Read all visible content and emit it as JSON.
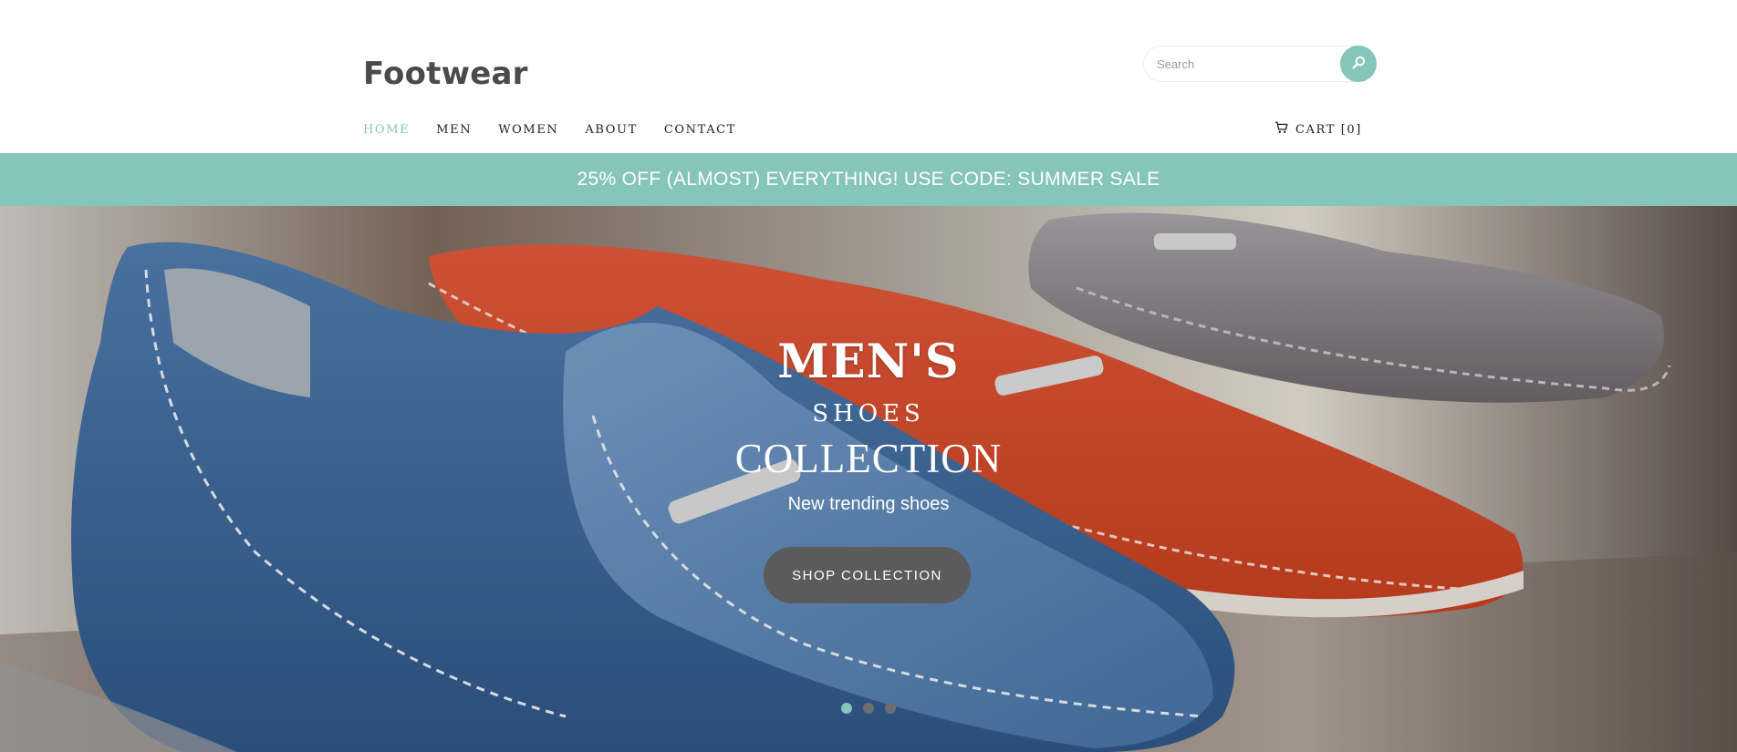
{
  "header": {
    "logo": "Footwear",
    "search": {
      "placeholder": "Search"
    },
    "nav": [
      {
        "label": "HOME",
        "active": true
      },
      {
        "label": "MEN",
        "active": false
      },
      {
        "label": "WOMEN",
        "active": false
      },
      {
        "label": "ABOUT",
        "active": false
      },
      {
        "label": "CONTACT",
        "active": false
      }
    ],
    "cart_label": "CART [0]"
  },
  "promo": {
    "text": "25% OFF (ALMOST) EVERYTHING! USE CODE: SUMMER SALE"
  },
  "hero": {
    "title": "MEN'S",
    "subtitle": "SHOES",
    "heading": "COLLECTION",
    "tagline": "New trending shoes",
    "button_label": "SHOP COLLECTION",
    "slide_count": 3,
    "active_slide": 1
  },
  "colors": {
    "accent": "#86c5b9",
    "button": "#5b5b5b",
    "logo": "#4a4a4a"
  },
  "icons": [
    "search-icon",
    "cart-icon"
  ]
}
